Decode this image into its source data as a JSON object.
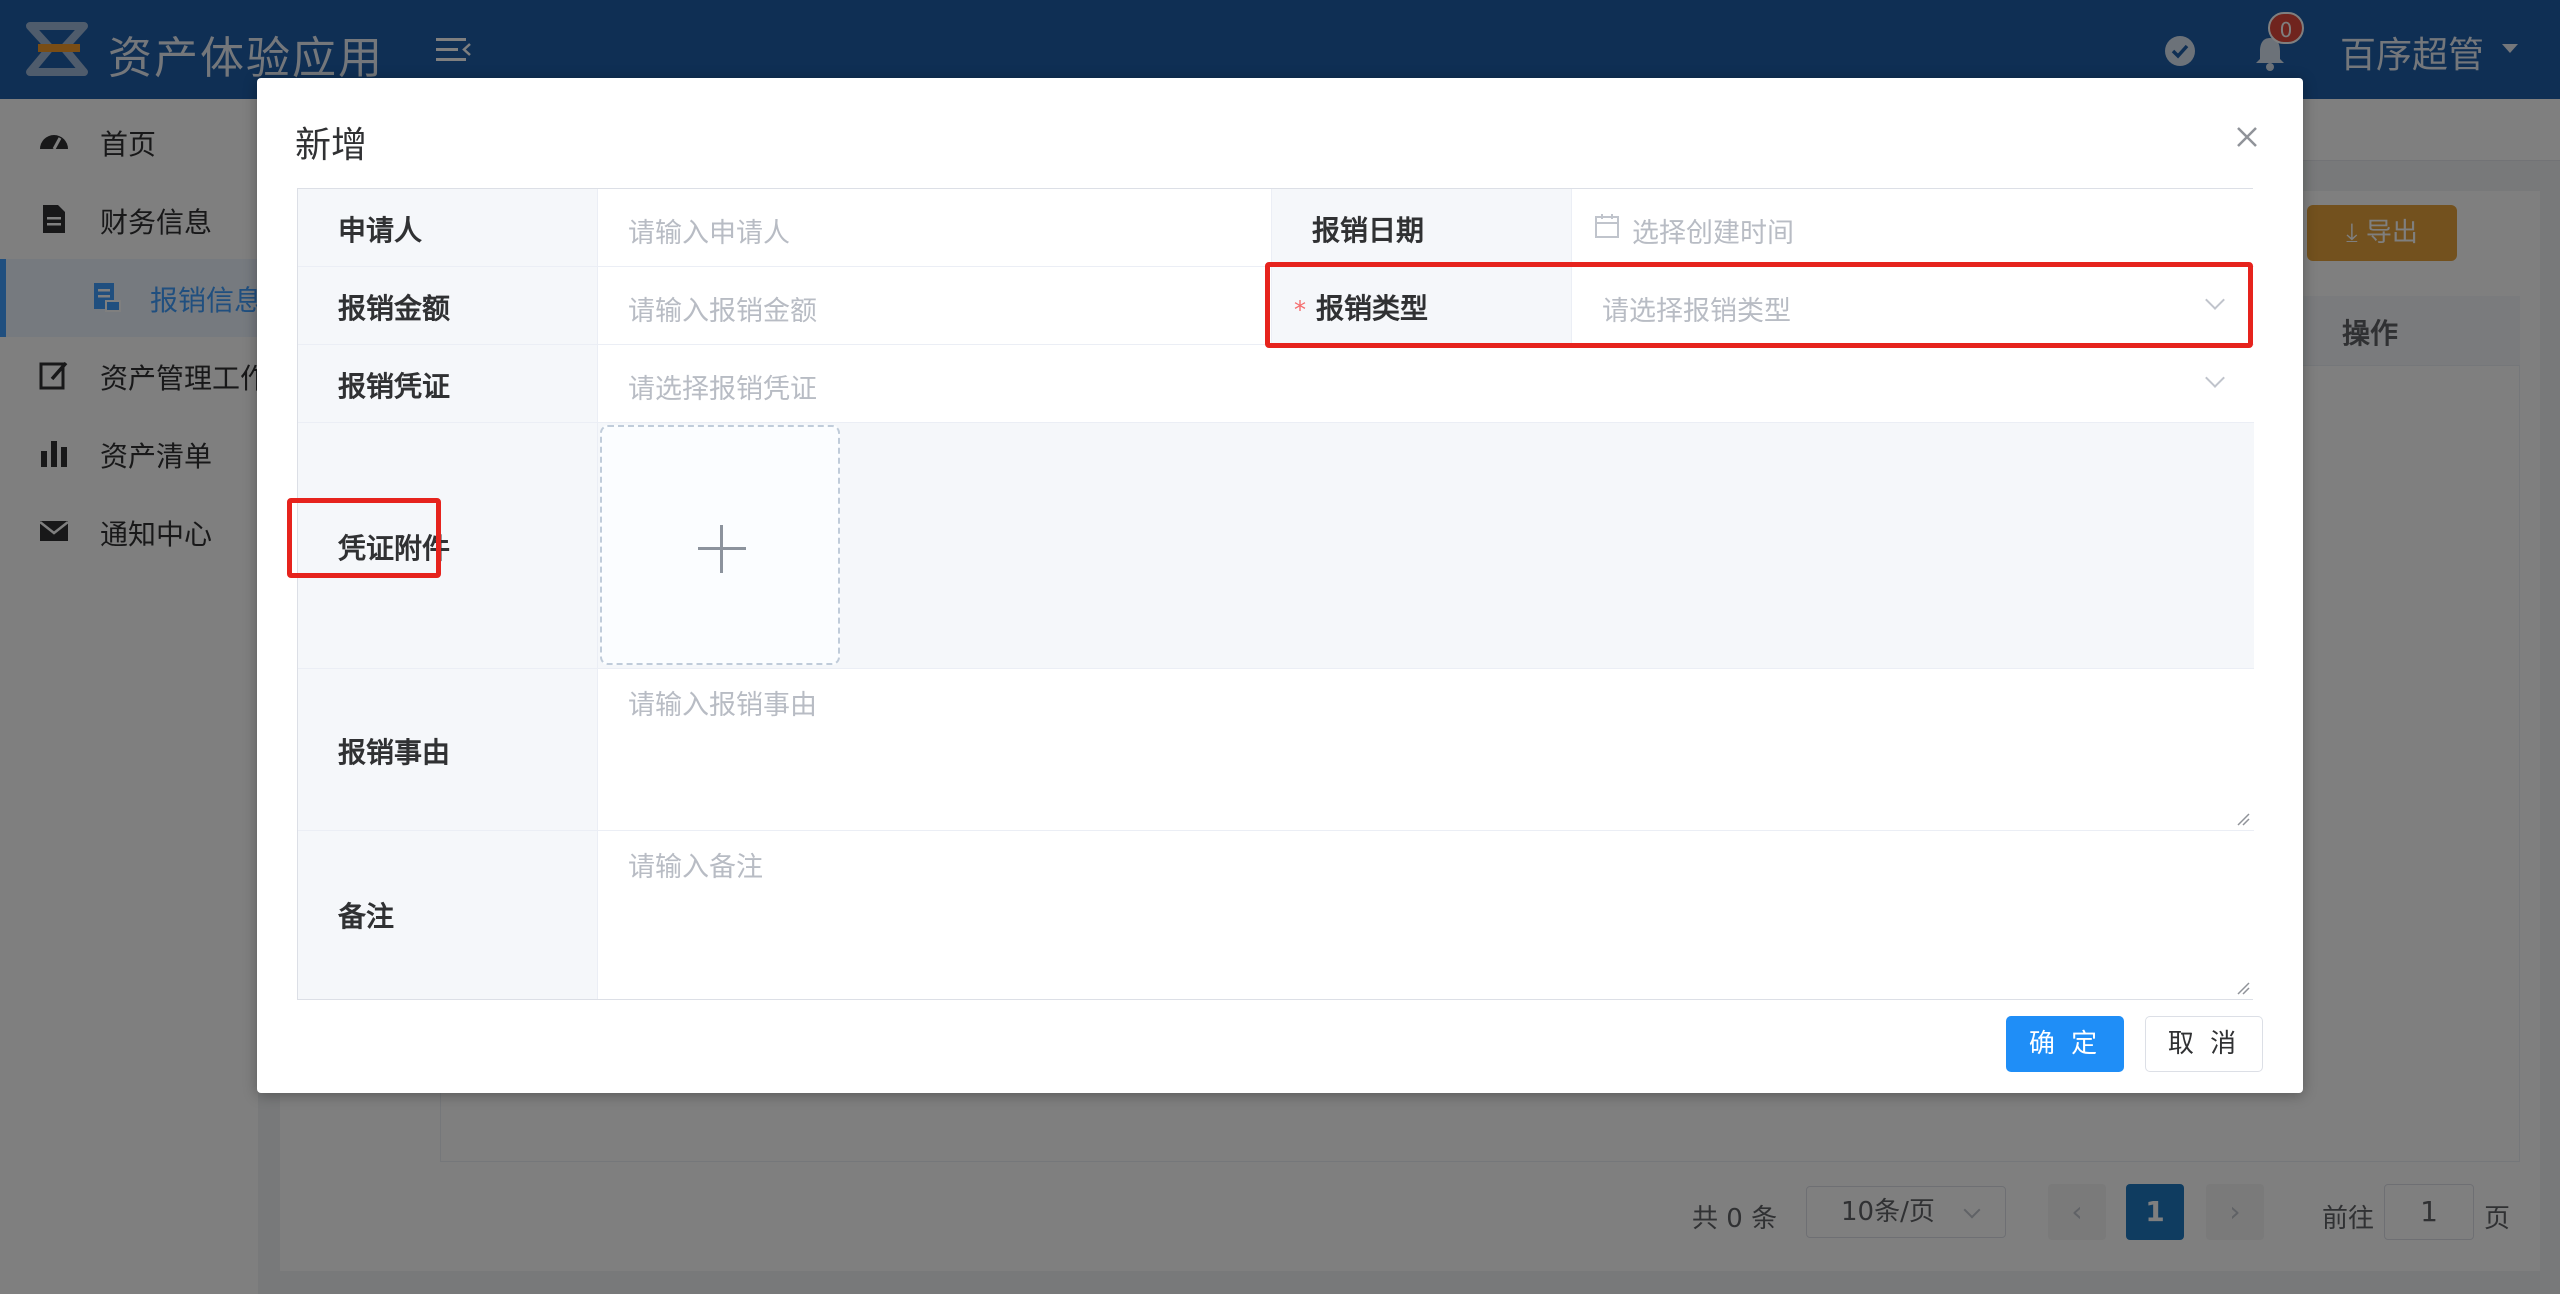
{
  "header": {
    "app_title": "资产体验应用",
    "notification_count": "0",
    "user_name": "百序超管"
  },
  "sidebar": {
    "items": [
      {
        "label": "首页",
        "icon": "dashboard-icon"
      },
      {
        "label": "财务信息",
        "icon": "document-icon"
      },
      {
        "label": "报销信息",
        "icon": "receipt-icon"
      },
      {
        "label": "资产管理工作",
        "icon": "edit-icon"
      },
      {
        "label": "资产清单",
        "icon": "bar-chart-icon"
      },
      {
        "label": "通知中心",
        "icon": "mail-icon"
      }
    ]
  },
  "main": {
    "export_label": "导出",
    "table": {
      "operation_header": "操作"
    },
    "pagination": {
      "total": "共 0 条",
      "page_size": "10条/页",
      "current_page": "1",
      "goto_label": "前往",
      "goto_value": "1",
      "page_suffix": "页"
    }
  },
  "dialog": {
    "title": "新增",
    "fields": {
      "applicant": {
        "label": "申请人",
        "placeholder": "请输入申请人"
      },
      "date": {
        "label": "报销日期",
        "placeholder": "选择创建时间"
      },
      "amount": {
        "label": "报销金额",
        "placeholder": "请输入报销金额"
      },
      "type": {
        "label": "报销类型",
        "placeholder": "请选择报销类型",
        "required_mark": "*"
      },
      "voucher": {
        "label": "报销凭证",
        "placeholder": "请选择报销凭证"
      },
      "attachment": {
        "label": "凭证附件"
      },
      "reason": {
        "label": "报销事由",
        "placeholder": "请输入报销事由"
      },
      "remark": {
        "label": "备注",
        "placeholder": "请输入备注"
      }
    },
    "confirm_label": "确 定",
    "cancel_label": "取 消"
  },
  "colors": {
    "header_bg": "#1f5ea8",
    "primary": "#409eff",
    "highlight": "#e6231d",
    "export": "#e6a23c"
  }
}
